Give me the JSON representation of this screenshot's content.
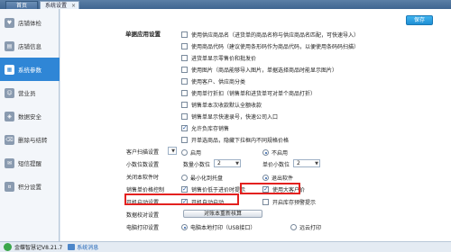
{
  "tabs": {
    "home": "首页",
    "active": "系统设置",
    "close": "×"
  },
  "sidebar": {
    "items": [
      {
        "label": "店铺体检"
      },
      {
        "label": "店铺信息"
      },
      {
        "label": "系统参数",
        "active": true
      },
      {
        "label": "营业员"
      },
      {
        "label": "数据安全"
      },
      {
        "label": "删除与结转"
      },
      {
        "label": "短信提醒"
      },
      {
        "label": "积分设置"
      }
    ]
  },
  "main": {
    "save_label": "保存",
    "section_title": "单据应用设置",
    "checkbox_rows": [
      {
        "label": "使用供应商品名（进货单的商品名称与供应商品名匹配，可快速导入）",
        "checked": false
      },
      {
        "label": "使用商品代码（建议使用条形码作为商品代码，以便使用条码码扫描）",
        "checked": false
      },
      {
        "label": "进货单显示零售价和批发价",
        "checked": false
      },
      {
        "label": "使用图片（商品能够导入图片，单据选择商品时能显示图片）",
        "checked": false
      },
      {
        "label": "使用客户、供应商分类",
        "checked": false
      },
      {
        "label": "使用单行折扣（销售单和进货单可对单个商品打折）",
        "checked": false
      },
      {
        "label": "销售单本次收款默认全额收款",
        "checked": false
      },
      {
        "label": "销售单显示快速录号，快速公司入口",
        "checked": false
      },
      {
        "label": "允许负库存销售",
        "checked": true
      },
      {
        "label": "开单选商品，隐藏下拉框内不同规格价格",
        "checked": false
      }
    ],
    "customer_scan": {
      "label": "客户扫描设置",
      "opt1": "启用",
      "opt2": "不启用",
      "selected": 2
    },
    "decimals": {
      "label": "小数位数设置",
      "qty_label": "数量小数位",
      "qty_value": "2",
      "price_label": "单价小数位",
      "price_value": "2"
    },
    "shutdown": {
      "label": "关闭本软件时",
      "opt1": "最小化到托盘",
      "opt2": "退出软件",
      "selected": 2
    },
    "price_control": {
      "label": "销售单价格控制",
      "opt1": "销售价低于进价时提示",
      "opt1_checked": true,
      "opt2": "使用大客户价",
      "opt2_checked": true
    },
    "startup": {
      "label": "开机启动设置",
      "opt1": "开机自动启动",
      "opt1_checked": true,
      "opt2": "开启库存预警提示",
      "opt2_checked": false
    },
    "data_check": {
      "label": "数据校对设置",
      "button": "对账本重新核算"
    },
    "printing": {
      "label": "电脑打印设置",
      "opt1": "电脑本地打印（USB接口）",
      "opt2": "远云打印",
      "selected": 1
    }
  },
  "status": {
    "app": "金蝶智慧记V8.21.7",
    "message": "系统消息"
  },
  "colors": {
    "accent": "#2f86d6",
    "highlight": "#e3211f"
  }
}
